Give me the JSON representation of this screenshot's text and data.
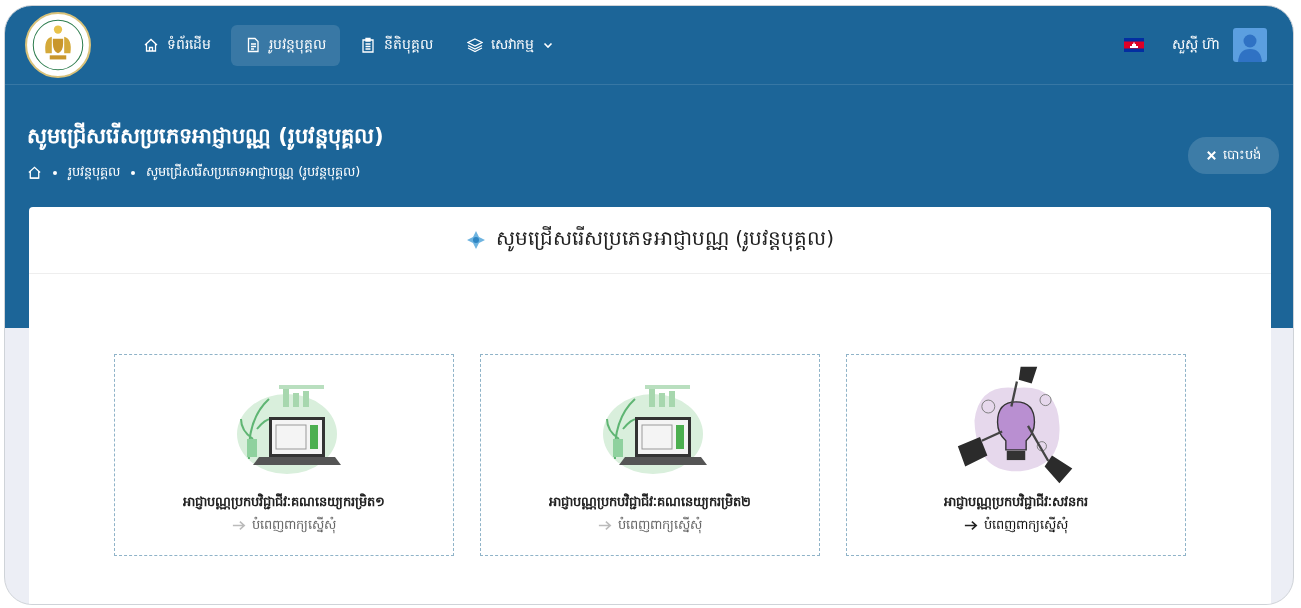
{
  "nav": {
    "items": [
      {
        "label": "ទំព័រដើម",
        "kind": "home",
        "selected": false,
        "dropdown": false
      },
      {
        "label": "រូបវន្តបុគ្គល",
        "kind": "document",
        "selected": true,
        "dropdown": false
      },
      {
        "label": "នីតិបុគ្គល",
        "kind": "clipboard",
        "selected": false,
        "dropdown": false
      },
      {
        "label": "សេវាកម្ម",
        "kind": "layers",
        "selected": false,
        "dropdown": true
      }
    ],
    "greeting": "សួស្តី ហ៊ា"
  },
  "page_header": {
    "title": "សូមជ្រើសរើសប្រភេទអាជ្ញាបណ្ណ (រូបវន្តបុគ្គល)",
    "breadcrumb": [
      "រូបវន្តបុគ្គល",
      "សូមជ្រើសរើសប្រភេទអាជ្ញាបណ្ណ (រូបវន្តបុគ្គល)"
    ],
    "cancel_button": "បោះបង់"
  },
  "panel": {
    "title": "សូមជ្រើសរើសប្រភេទអាជ្ញាបណ្ណ (រូបវន្តបុគ្គល)",
    "cards": [
      {
        "kind": "laptop",
        "title": "អាជ្ញាបណ្ណប្រកបវិជ្ជាជីវៈគណនេយ្យករម្រិត១",
        "link": "បំពេញពាក្យស្នើសុំ",
        "hovered": false
      },
      {
        "kind": "laptop",
        "title": "អាជ្ញាបណ្ណប្រកបវិជ្ជាជីវៈគណនេយ្យករម្រិត២",
        "link": "បំពេញពាក្យស្នើសុំ",
        "hovered": false
      },
      {
        "kind": "lightbulb",
        "title": "អាជ្ញាបណ្ណប្រកបវិជ្ជាជីវៈសវនករ",
        "link": "បំពេញពាក្យស្នើសុំ",
        "hovered": true
      }
    ]
  }
}
